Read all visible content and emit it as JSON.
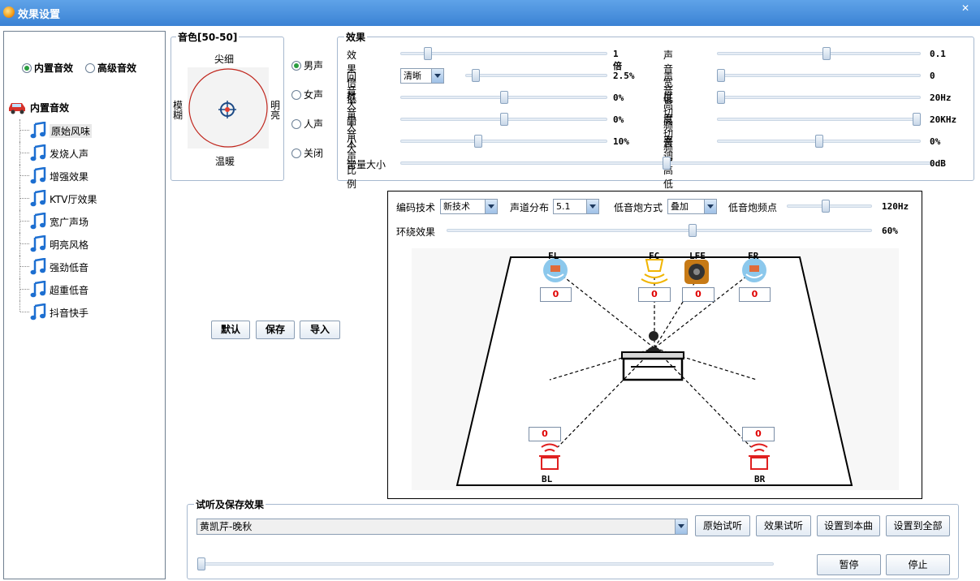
{
  "window": {
    "title": "效果设置",
    "close": "✕"
  },
  "left": {
    "radio_builtin": "内置音效",
    "radio_advanced": "高级音效",
    "tree_root": "内置音效",
    "items": [
      "原始风味",
      "发烧人声",
      "增强效果",
      "KTV厅效果",
      "宽广声场",
      "明亮风格",
      "强劲低音",
      "超重低音",
      "抖音快手"
    ]
  },
  "timbre": {
    "title": "音色[50-50]",
    "top": "尖细",
    "bottom": "温暖",
    "left": "模糊",
    "right": "明亮",
    "voices": [
      "男声",
      "女声",
      "人声",
      "关闭"
    ],
    "voice_selected": 0
  },
  "effects": {
    "title": "效果",
    "left_rows": [
      {
        "label": "效果倍数",
        "value": "1倍",
        "level": 0.12
      },
      {
        "label": "回音大小",
        "value": "2.5%",
        "level": 0.05,
        "combo": "清晰"
      },
      {
        "label": "低音大小",
        "value": "0%",
        "level": 0.5
      },
      {
        "label": "高音大小",
        "value": "0%",
        "level": 0.5
      },
      {
        "label": "人声比例",
        "value": "10%",
        "level": 0.37
      }
    ],
    "right_rows": [
      {
        "label": "声音宽度",
        "value": "0.1",
        "level": 0.54
      },
      {
        "label": "声音高度",
        "value": "0",
        "level": 0.0
      },
      {
        "label": "低切频率",
        "value": "20Hz",
        "level": 0.0
      },
      {
        "label": "高切频率",
        "value": "20KHz",
        "level": 1.0
      },
      {
        "label": "音调高低",
        "value": "0%",
        "level": 0.5
      }
    ],
    "volume": {
      "label": "音量大小",
      "value": "0dB",
      "level": 0.5
    }
  },
  "buttons": {
    "default": "默认",
    "save": "保存",
    "import": "导入"
  },
  "surround": {
    "codec_label": "编码技术",
    "codec_value": "新技术",
    "channel_label": "声道分布",
    "channel_value": "5.1",
    "sub_label": "低音炮方式",
    "sub_value": "叠加",
    "sub_freq_label": "低音炮频点",
    "sub_freq_value": "120Hz",
    "sub_freq_level": 0.45,
    "surround_label": "环绕效果",
    "surround_value": "60%",
    "surround_level": 0.58,
    "speakers": {
      "FL": {
        "label": "FL",
        "value": "0"
      },
      "FC": {
        "label": "FC",
        "value": "0"
      },
      "LFE": {
        "label": "LFE",
        "value": "0"
      },
      "FR": {
        "label": "FR",
        "value": "0"
      },
      "BL": {
        "label": "BL",
        "value": "0"
      },
      "BR": {
        "label": "BR",
        "value": "0"
      }
    }
  },
  "preview": {
    "title": "试听及保存效果",
    "song": "黄凯芹-晚秋",
    "btn_original": "原始试听",
    "btn_effect": "效果试听",
    "btn_save_this": "设置到本曲",
    "btn_save_all": "设置到全部",
    "btn_pause": "暂停",
    "btn_stop": "停止",
    "progress": 0.0
  },
  "colors": {
    "accent": "#3b82d4",
    "red": "#e00000",
    "select_green": "#2a9d3f"
  }
}
